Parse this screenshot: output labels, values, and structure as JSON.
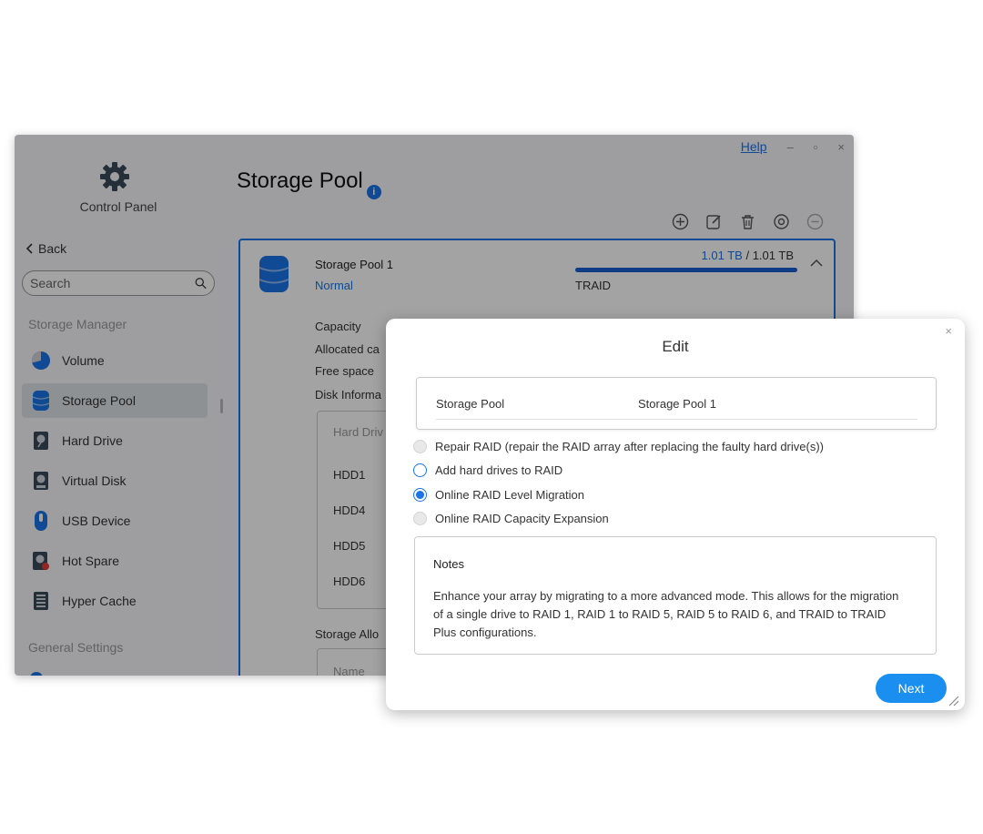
{
  "window": {
    "help_link": "Help",
    "minimize_glyph": "–",
    "maximize_glyph": "▫",
    "close_glyph": "×"
  },
  "sidebar": {
    "app_title": "Control Panel",
    "back_label": "Back",
    "search_placeholder": "Search",
    "section_storage": "Storage Manager",
    "section_general": "General Settings",
    "items": [
      {
        "label": "Volume",
        "icon": "volume-pie-icon"
      },
      {
        "label": "Storage Pool",
        "icon": "storage-pool-icon"
      },
      {
        "label": "Hard Drive",
        "icon": "hard-drive-icon"
      },
      {
        "label": "Virtual Disk",
        "icon": "virtual-disk-icon"
      },
      {
        "label": "USB Device",
        "icon": "usb-device-icon"
      },
      {
        "label": "Hot Spare",
        "icon": "hot-spare-icon"
      },
      {
        "label": "Hyper Cache",
        "icon": "hyper-cache-icon"
      }
    ]
  },
  "main": {
    "title": "Storage Pool",
    "toolbar_icons": [
      "add-icon",
      "edit-icon",
      "delete-icon",
      "settings-icon",
      "more-icon"
    ],
    "pool": {
      "name": "Storage Pool 1",
      "status": "Normal",
      "used": "1.01 TB",
      "separator": "/",
      "total": "1.01 TB",
      "used_fraction": 1.0,
      "raid_type": "TRAID",
      "labels": {
        "capacity": "Capacity",
        "allocated": "Allocated ca",
        "free": "Free space",
        "disk_info": "Disk Informa",
        "storage_alloc": "Storage Allo"
      },
      "disk_header": "Hard Driv",
      "disks": [
        "HDD1",
        "HDD4",
        "HDD5",
        "HDD6"
      ],
      "alloc_header": "Name"
    }
  },
  "dialog": {
    "title": "Edit",
    "close_glyph": "×",
    "pool_key": "Storage Pool",
    "pool_value": "Storage Pool 1",
    "options": [
      {
        "label": "Repair RAID (repair the RAID array after replacing the faulty hard drive(s))",
        "state": "disabled"
      },
      {
        "label": "Add hard drives to RAID",
        "state": "unchecked"
      },
      {
        "label": "Online RAID Level Migration",
        "state": "checked"
      },
      {
        "label": "Online RAID Capacity Expansion",
        "state": "disabled"
      }
    ],
    "notes_title": "Notes",
    "notes_body": "Enhance your array by migrating to a more advanced mode. This allows for the migration of a single drive to RAID 1, RAID 1 to RAID 5, RAID 5 to RAID 6, and TRAID to TRAID Plus configurations.",
    "next_label": "Next"
  },
  "colors": {
    "accent": "#1a73e8",
    "button": "#1a8ff0"
  }
}
